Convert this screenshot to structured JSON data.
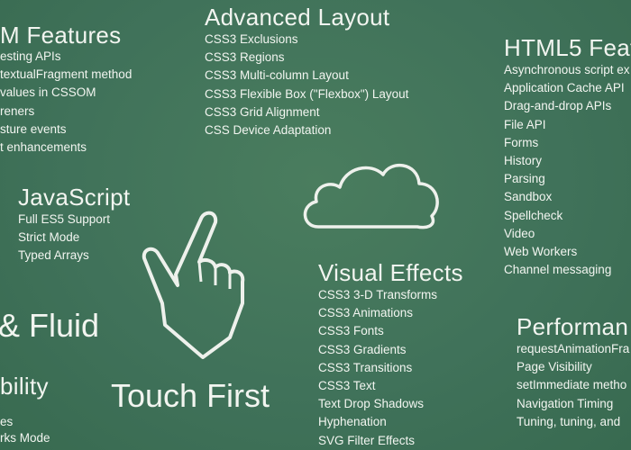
{
  "dom": {
    "title": "M Features",
    "items": [
      "esting APIs",
      "textualFragment method",
      "values in CSSOM",
      "reners",
      "sture events",
      "t enhancements"
    ]
  },
  "layout": {
    "title": "Advanced Layout",
    "items": [
      "CSS3 Exclusions",
      "CSS3 Regions",
      "CSS3 Multi-column Layout",
      "CSS3 Flexible Box (\"Flexbox\") Layout",
      "CSS3 Grid Alignment",
      "CSS Device Adaptation"
    ]
  },
  "html5": {
    "title": "HTML5 Feat",
    "items": [
      "Asynchronous script ex",
      "Application Cache API",
      "Drag-and-drop APIs",
      "File API",
      "Forms",
      "History",
      "Parsing",
      "Sandbox",
      "Spellcheck",
      "Video",
      "Web Workers",
      "Channel messaging"
    ]
  },
  "javascript": {
    "title": "JavaScript",
    "items": [
      "Full ES5 Support",
      "Strict Mode",
      "Typed Arrays"
    ]
  },
  "visual": {
    "title": "Visual Effects",
    "items": [
      "CSS3 3-D Transforms",
      "CSS3 Animations",
      "CSS3 Fonts",
      "CSS3 Gradients",
      "CSS3 Transitions",
      "CSS3 Text",
      "Text Drop Shadows",
      "Hyphenation",
      "SVG Filter Effects"
    ]
  },
  "performance": {
    "title": "Performan",
    "items": [
      "requestAnimationFra",
      "Page Visibility",
      "setImmediate metho",
      "Navigation Timing",
      "Tuning, tuning, and"
    ]
  },
  "fluid": {
    "title": "& Fluid"
  },
  "compat": {
    "title": "bility",
    "items": [
      "es",
      "rks Mode"
    ]
  },
  "touch": {
    "title": "Touch First"
  },
  "icons": {
    "hand": "pointing-hand-icon",
    "cloud": "cloud-icon"
  }
}
